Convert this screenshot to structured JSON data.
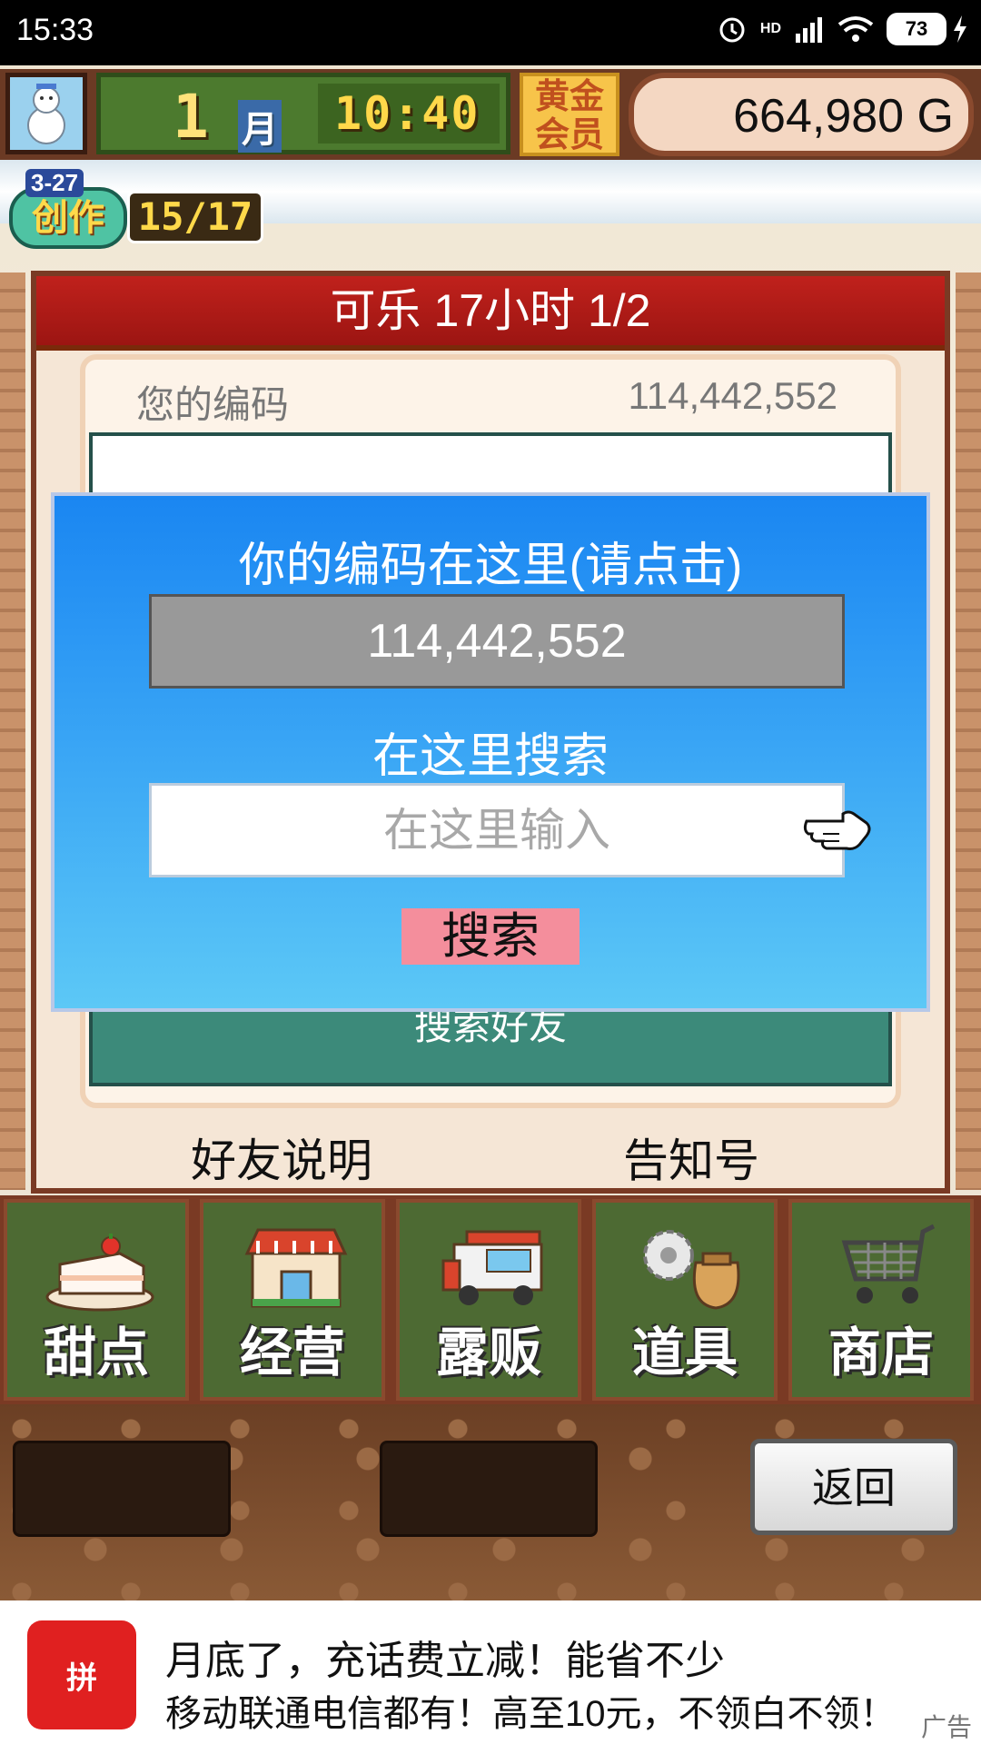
{
  "status_bar": {
    "time": "15:33",
    "battery": "73",
    "network": "HD"
  },
  "hud": {
    "month_number": "1",
    "month_unit": "月",
    "clock": "10:40",
    "member_badge": "黄金会员",
    "money": "664,980 G"
  },
  "create_badge": {
    "date": "3-27",
    "label": "创作",
    "count": "15/17"
  },
  "panel": {
    "title": "可乐  17小时 1/2",
    "your_code_label": "您的编码",
    "your_code_value": "114,442,552",
    "search_friend_label": "搜索好友",
    "friend_help_label": "好友说明",
    "notice_label": "告知号"
  },
  "dialog": {
    "title": "你的编码在这里(请点击)",
    "code_value": "114,442,552",
    "search_label": "在这里搜索",
    "search_placeholder": "在这里输入",
    "search_button": "搜索"
  },
  "menu": {
    "items": [
      {
        "label": "甜点",
        "icon": "cake-icon"
      },
      {
        "label": "经营",
        "icon": "shop-building-icon"
      },
      {
        "label": "露贩",
        "icon": "food-truck-icon"
      },
      {
        "label": "道具",
        "icon": "items-bag-icon"
      },
      {
        "label": "商店",
        "icon": "shopping-cart-icon"
      }
    ]
  },
  "back_button": "返回",
  "ad": {
    "logo_text": "拼",
    "line1": "月底了，充话费立减！能省不少",
    "line2": "移动联通电信都有！高至10元，不领白不领！",
    "tag": "广告"
  },
  "colors": {
    "dialog_top": "#1a86f2",
    "dialog_bottom": "#5cc8f6",
    "title_bar": "#c0211c",
    "search_button": "#f48e9c",
    "menu_tile": "#4d6a33"
  }
}
